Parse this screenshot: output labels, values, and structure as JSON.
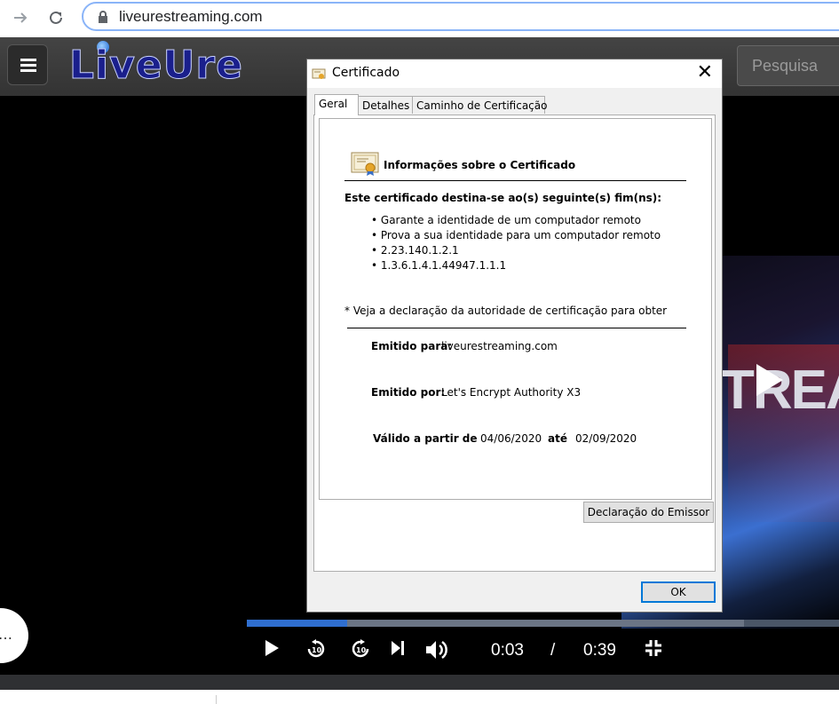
{
  "browser": {
    "url": "liveurestreaming.com",
    "forward_icon": "arrow-right-icon",
    "reload_icon": "reload-icon"
  },
  "site": {
    "logo_text": "LiveUre",
    "search_placeholder": "Pesquisa"
  },
  "video": {
    "overlay_text": "TREAM",
    "current_time": "0:03",
    "separator": "/",
    "duration": "0:39",
    "progress_fraction": 0.17,
    "buffer_fraction": 0.84
  },
  "dialog": {
    "title": "Certificado",
    "close_label": "✕",
    "tabs": [
      "Geral",
      "Detalhes",
      "Caminho de Certificação"
    ],
    "info_heading": "Informações sobre o Certificado",
    "purpose_heading": "Este certificado destina-se ao(s) seguinte(s) fim(ns):",
    "purposes": [
      "Garante a identidade de um computador remoto",
      "Prova a sua identidade para um computador remoto",
      "2.23.140.1.2.1",
      "1.3.6.1.4.1.44947.1.1.1"
    ],
    "note": "* Veja a declaração da autoridade de certificação para obter",
    "issued_to_label": "Emitido para:",
    "issued_to_value": "liveurestreaming.com",
    "issued_by_label": "Emitido por:",
    "issued_by_value": "Let's Encrypt Authority X3",
    "valid_from_label": "Válido a partir de",
    "valid_from_value": "04/06/2020",
    "valid_to_label": "até",
    "valid_to_value": "02/09/2020",
    "issuer_statement_button": "Declaração do Emissor",
    "ok_button": "OK"
  }
}
